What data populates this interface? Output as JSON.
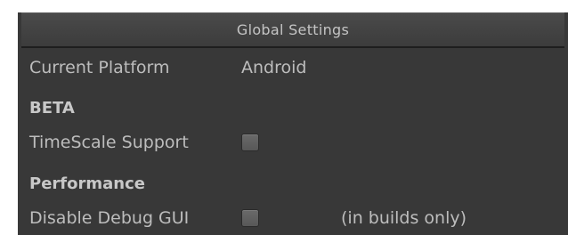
{
  "panel": {
    "title": "Global Settings"
  },
  "rows": {
    "platform_label": "Current Platform",
    "platform_value": "Android",
    "beta_heading": "BETA",
    "timescale_label": "TimeScale Support",
    "timescale_checked": false,
    "performance_heading": "Performance",
    "debug_label": "Disable Debug GUI",
    "debug_checked": false,
    "debug_note": "(in builds only)"
  }
}
